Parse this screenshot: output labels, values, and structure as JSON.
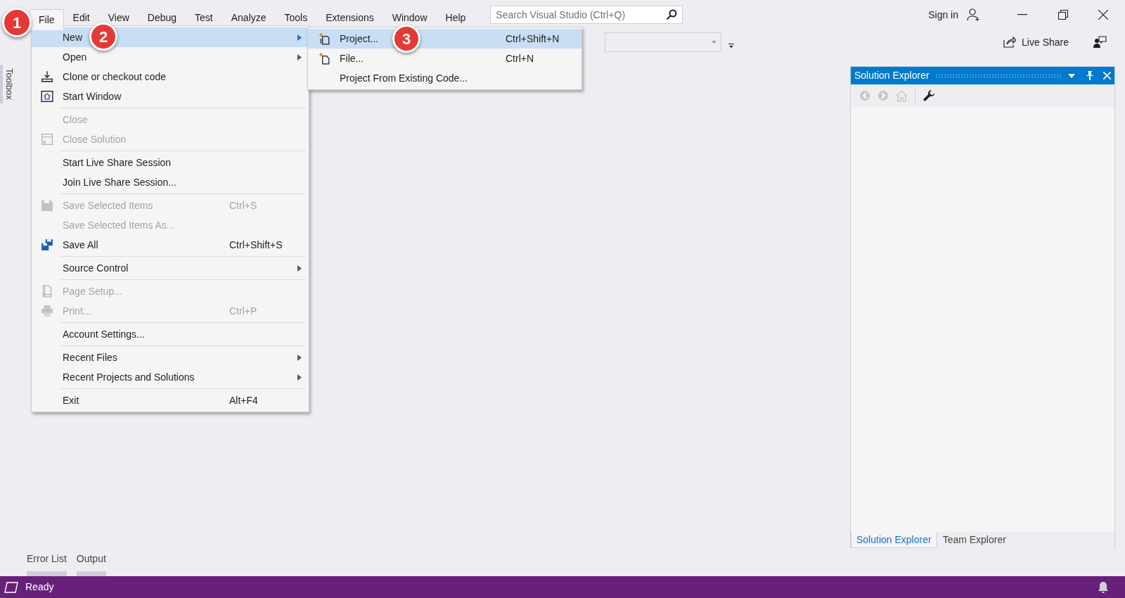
{
  "menu_bar": [
    {
      "label": "File",
      "selected": true
    },
    {
      "label": "Edit",
      "selected": false
    },
    {
      "label": "View",
      "selected": false
    },
    {
      "label": "Debug",
      "selected": false
    },
    {
      "label": "Test",
      "selected": false
    },
    {
      "label": "Analyze",
      "selected": false
    },
    {
      "label": "Tools",
      "selected": false
    },
    {
      "label": "Extensions",
      "selected": false
    },
    {
      "label": "Window",
      "selected": false
    },
    {
      "label": "Help",
      "selected": false
    }
  ],
  "search": {
    "placeholder": "Search Visual Studio (Ctrl+Q)"
  },
  "sign_in": "Sign in",
  "toolbar": {
    "live_share": "Live Share"
  },
  "toolbox": "Toolbox",
  "file_menu": [
    [
      {
        "label": "New",
        "has_submenu": true,
        "selected": true,
        "disabled": false
      },
      {
        "label": "Open",
        "has_submenu": true,
        "selected": false,
        "disabled": false
      },
      {
        "label": "Clone or checkout code",
        "kind": "download",
        "selected": false,
        "disabled": false
      },
      {
        "label": "Start Window",
        "kind": "home",
        "selected": false,
        "disabled": false
      }
    ],
    [
      {
        "label": "Close",
        "selected": false,
        "disabled": true
      },
      {
        "label": "Close Solution",
        "kind": "close-solution",
        "selected": false,
        "disabled": true
      }
    ],
    [
      {
        "label": "Start Live Share Session",
        "selected": false,
        "disabled": false
      },
      {
        "label": "Join Live Share Session...",
        "selected": false,
        "disabled": false
      }
    ],
    [
      {
        "label": "Save Selected Items",
        "shortcut": "Ctrl+S",
        "kind": "save",
        "selected": false,
        "disabled": true
      },
      {
        "label": "Save Selected Items As...",
        "selected": false,
        "disabled": true
      },
      {
        "label": "Save All",
        "shortcut": "Ctrl+Shift+S",
        "kind": "save-all",
        "selected": false,
        "disabled": false
      }
    ],
    [
      {
        "label": "Source Control",
        "has_submenu": true,
        "selected": false,
        "disabled": false
      }
    ],
    [
      {
        "label": "Page Setup...",
        "kind": "page",
        "selected": false,
        "disabled": true
      },
      {
        "label": "Print...",
        "shortcut": "Ctrl+P",
        "kind": "print",
        "selected": false,
        "disabled": true
      }
    ],
    [
      {
        "label": "Account Settings...",
        "selected": false,
        "disabled": false
      }
    ],
    [
      {
        "label": "Recent Files",
        "has_submenu": true,
        "selected": false,
        "disabled": false
      },
      {
        "label": "Recent Projects and Solutions",
        "has_submenu": true,
        "selected": false,
        "disabled": false
      }
    ],
    [
      {
        "label": "Exit",
        "shortcut": "Alt+F4",
        "selected": false,
        "disabled": false
      }
    ]
  ],
  "new_submenu": [
    {
      "label": "Project...",
      "shortcut": "Ctrl+Shift+N",
      "kind": "new-project",
      "selected": true
    },
    {
      "label": "File...",
      "shortcut": "Ctrl+N",
      "kind": "new-file",
      "selected": false
    },
    {
      "label": "Project From Existing Code...",
      "selected": false
    }
  ],
  "callouts": [
    "1",
    "2",
    "3"
  ],
  "solution_explorer": {
    "title": "Solution Explorer",
    "tabs": [
      {
        "label": "Solution Explorer",
        "selected": true
      },
      {
        "label": "Team Explorer",
        "selected": false
      }
    ]
  },
  "bottom_tabs": [
    {
      "label": "Error List"
    },
    {
      "label": "Output"
    }
  ],
  "status_bar": {
    "text": "Ready"
  }
}
